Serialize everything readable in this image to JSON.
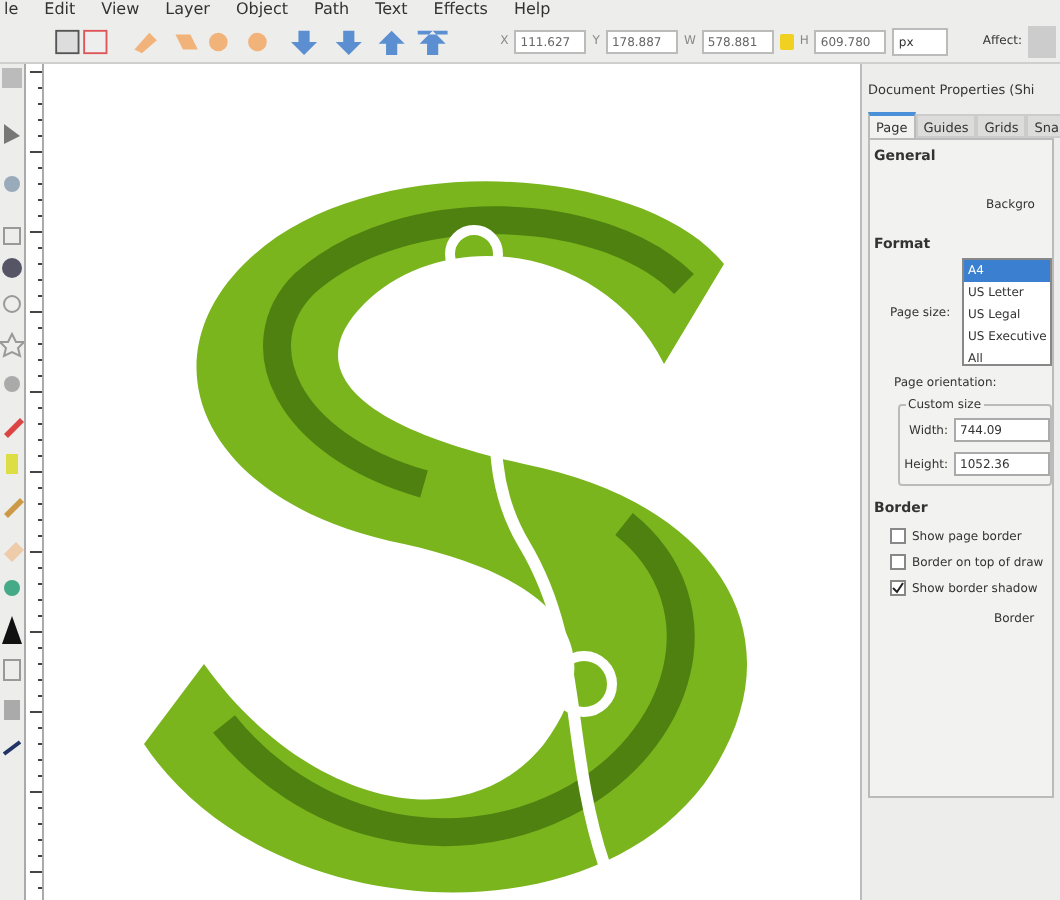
{
  "menu_bar": [
    "le",
    "Edit",
    "View",
    "Layer",
    "Object",
    "Path",
    "Text",
    "Effects",
    "Help"
  ],
  "tool_controls": {
    "fields": [
      {
        "label": "X",
        "value": "111.627"
      },
      {
        "label": "Y",
        "value": "178.887"
      },
      {
        "label": "W",
        "value": "578.881"
      },
      {
        "label": "H",
        "value": "609.780"
      }
    ],
    "unit": "px",
    "affect_label": "Affect:"
  },
  "dialog": {
    "title": "Document Properties (Shi",
    "tabs": [
      {
        "label": "Page",
        "selected": true
      },
      {
        "label": "Guides",
        "selected": false
      },
      {
        "label": "Grids",
        "selected": false
      },
      {
        "label": "Sna",
        "selected": false
      }
    ],
    "general_heading": "General",
    "background_label": "Backgro",
    "format_heading": "Format",
    "page_size_label": "Page size:",
    "page_sizes": [
      {
        "label": "A4",
        "selected": true
      },
      {
        "label": "US Letter",
        "selected": false
      },
      {
        "label": "US Legal",
        "selected": false
      },
      {
        "label": "US Executive",
        "selected": false
      },
      {
        "label": "All",
        "selected": false
      }
    ],
    "orientation_label": "Page orientation:",
    "custom_size_legend": "Custom size",
    "width": {
      "label": "Width:",
      "value": "744.09"
    },
    "height": {
      "label": "Height:",
      "value": "1052.36"
    },
    "border_heading": "Border",
    "border_options": [
      {
        "label": "Show page border",
        "checked": false
      },
      {
        "label": "Border on top of draw",
        "checked": false
      },
      {
        "label": "Show border shadow",
        "checked": true
      }
    ],
    "border_color_label": "Border"
  }
}
